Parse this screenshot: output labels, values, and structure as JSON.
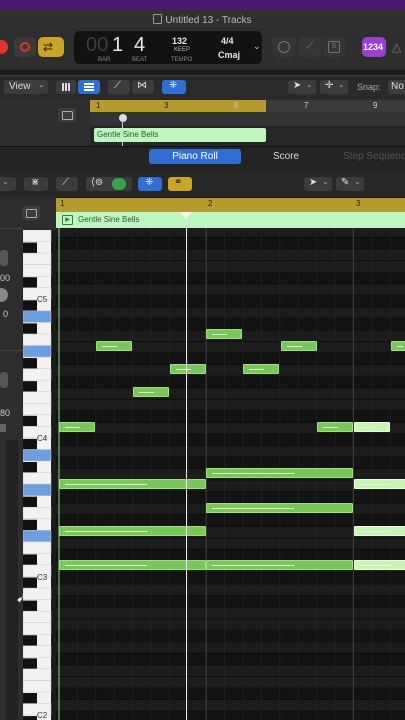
{
  "window": {
    "title": "Untitled 13 - Tracks"
  },
  "lcd": {
    "bar": "1",
    "beat": "4",
    "bar_label": "BAR",
    "beat_label": "BEAT",
    "bar_lead": "00",
    "tempo": "132",
    "tempo_mode": "KEEP",
    "tempo_label": "TEMPO",
    "time_sig": "4/4",
    "key": "Cmaj"
  },
  "toolbar": {
    "count_in_badge": "1234"
  },
  "tracks_bar": {
    "view_menu": "View",
    "snap_label": "Snap:",
    "snap_value": "No"
  },
  "tracks_ruler": {
    "marks": [
      "1",
      "3",
      "5",
      "7",
      "9"
    ]
  },
  "tracks_region": {
    "name": "Gentle Sine Bells"
  },
  "editor_tabs": {
    "piano_roll": "Piano Roll",
    "score": "Score",
    "step_sequencer": "Step Sequenc"
  },
  "pr_ruler": {
    "marks": [
      "1",
      "2",
      "3"
    ]
  },
  "pr_region": {
    "name": "Gentle Sine Bells"
  },
  "key_labels": {
    "c5": "C5",
    "c4": "C4",
    "c3": "C3",
    "c2": "C2"
  },
  "inspector": {
    "val1": "00",
    "val2": "0",
    "val3": "80"
  },
  "colors": {
    "accent_blue": "#2f6fd1",
    "region_green": "#bff6bf",
    "note_green": "#79c65a",
    "ruler_gold": "#b59a2e",
    "record_red": "#e0352b"
  }
}
